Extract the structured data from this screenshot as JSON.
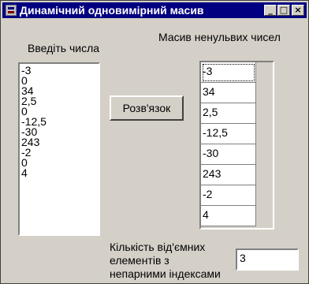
{
  "window": {
    "title": "Динамічний одновимірний масив",
    "buttons": {
      "minimize": "_",
      "maximize": "□",
      "close": "×"
    }
  },
  "input_section": {
    "label": "Введіть числа",
    "values": [
      "-3",
      "0",
      "34",
      "2,5",
      "0",
      "-12,5",
      "-30",
      "243",
      "-2",
      "0",
      "4"
    ]
  },
  "solve_button": {
    "label": "Розв'язок"
  },
  "output_section": {
    "label": "Масив ненульвих чисел",
    "values": [
      "-3",
      "34",
      "2,5",
      "-12,5",
      "-30",
      "243",
      "-2",
      "4"
    ]
  },
  "count_section": {
    "label_lines": [
      "Кількість від'ємних",
      "елементів з",
      "непарними індексами"
    ],
    "value": "3"
  }
}
